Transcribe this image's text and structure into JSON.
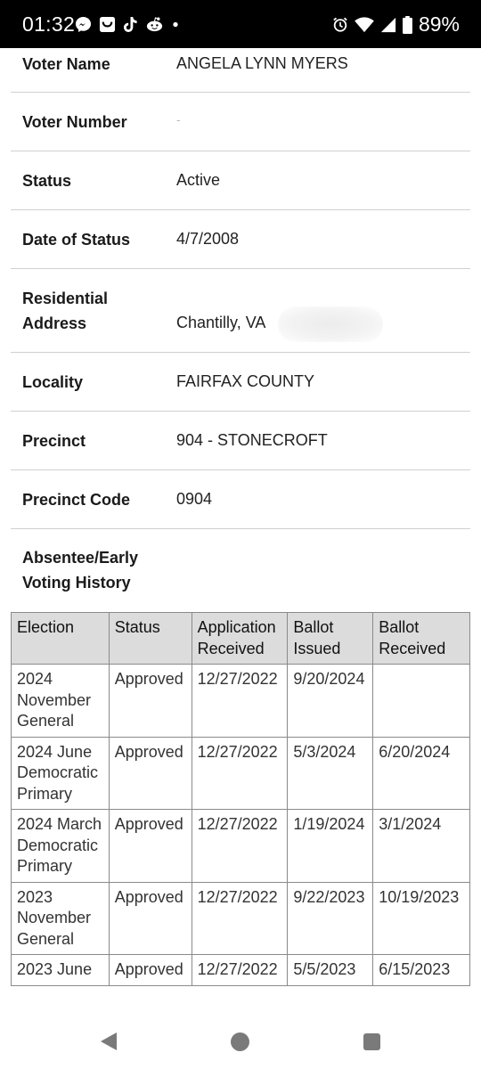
{
  "status_bar": {
    "time": "01:32",
    "battery": "89%",
    "left_icons": [
      "messenger-icon",
      "inbox-icon",
      "tiktok-icon",
      "reddit-icon",
      "dot-icon"
    ],
    "right_icons": [
      "alarm-icon",
      "wifi-icon",
      "signal-icon",
      "battery-icon"
    ]
  },
  "voter_info": [
    {
      "label": "Voter Name",
      "value": "ANGELA LYNN MYERS"
    },
    {
      "label": "Voter Number",
      "value": "-"
    },
    {
      "label": "Status",
      "value": "Active"
    },
    {
      "label": "Date of Status",
      "value": "4/7/2008"
    },
    {
      "label": "Residential Address",
      "value": "Chantilly, VA"
    },
    {
      "label": "Locality",
      "value": "FAIRFAX COUNTY"
    },
    {
      "label": "Precinct",
      "value": "904 - STONECROFT"
    },
    {
      "label": "Precinct Code",
      "value": "0904"
    }
  ],
  "history": {
    "title": "Absentee/Early Voting History",
    "headers": [
      "Election",
      "Status",
      "Application Received",
      "Ballot Issued",
      "Ballot Received"
    ],
    "rows": [
      [
        "2024 November General",
        "Approved",
        "12/27/2022",
        "9/20/2024",
        ""
      ],
      [
        "2024 June Democratic Primary",
        "Approved",
        "12/27/2022",
        "5/3/2024",
        "6/20/2024"
      ],
      [
        "2024 March Democratic Primary",
        "Approved",
        "12/27/2022",
        "1/19/2024",
        "3/1/2024"
      ],
      [
        "2023 November General",
        "Approved",
        "12/27/2022",
        "9/22/2023",
        "10/19/2023"
      ],
      [
        "2023 June",
        "Approved",
        "12/27/2022",
        "5/5/2023",
        "6/15/2023"
      ]
    ]
  },
  "nav_bar": {
    "buttons": [
      "back-button",
      "home-button",
      "recents-button"
    ]
  }
}
